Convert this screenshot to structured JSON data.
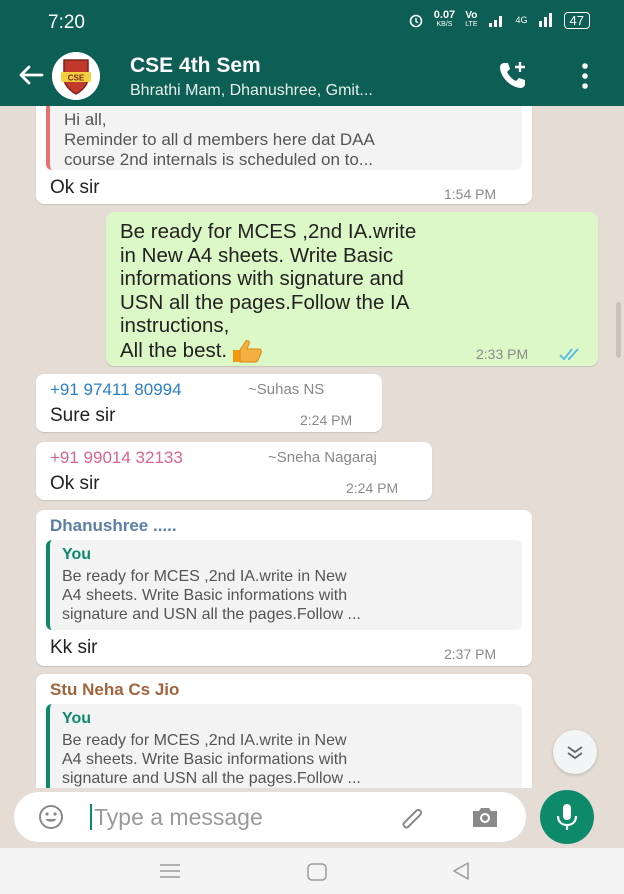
{
  "status_bar": {
    "time": "7:20",
    "speed_value": "0.07",
    "speed_unit": "KB/S",
    "volte_top": "Vo",
    "volte_bottom": "LTE",
    "network": "4G",
    "battery": "47"
  },
  "header": {
    "title": "CSE 4th Sem",
    "members": "Bhrathi Mam, Dhanushree, Gmit...",
    "avatar_text": "CSE"
  },
  "messages": [
    {
      "quote_text_1": "Hi all,",
      "quote_text_2": "Reminder to all d members here dat DAA",
      "quote_text_3": "course 2nd internals is scheduled on to...",
      "text": "Ok sir",
      "time": "1:54 PM"
    },
    {
      "lines": [
        "Be ready for MCES ,2nd IA.write",
        "in New A4 sheets. Write Basic",
        "informations with signature and",
        "USN all the pages.Follow the IA",
        "instructions,",
        "All the best."
      ],
      "time": "2:33 PM",
      "status_icon": "double-check-icon"
    },
    {
      "sender": "+91 97411 80994",
      "sender_name": "~Suhas NS",
      "text": "Sure sir",
      "time": "2:24 PM"
    },
    {
      "sender": "+91 99014 32133",
      "sender_name": "~Sneha Nagaraj",
      "text": "Ok sir",
      "time": "2:24 PM"
    },
    {
      "sender": "Dhanushree .....",
      "quote_name": "You",
      "quote_text_1": "Be ready for MCES ,2nd IA.write in New",
      "quote_text_2": "A4 sheets. Write Basic informations with",
      "quote_text_3": "signature and USN all the pages.Follow ...",
      "text": "Kk sir",
      "time": "2:37 PM"
    },
    {
      "sender": "Stu Neha Cs Jio",
      "quote_name": "You",
      "quote_text_1": "Be ready for MCES ,2nd IA.write in New",
      "quote_text_2": "A4 sheets. Write Basic informations with",
      "quote_text_3": "signature and USN all the pages.Follow ..."
    }
  ],
  "input": {
    "placeholder": "Type a message"
  },
  "colors": {
    "header": "#0d5e54",
    "accent": "#0d8a6a",
    "outgoing_bubble": "#dcf8c6",
    "chat_background": "#e5ddd5",
    "sender_blue": "#2b7fc9",
    "sender_pink": "#d9648f",
    "sender_slate": "#5b7fa6",
    "sender_brown": "#a0643c",
    "quote_bar_red": "#e57373"
  }
}
